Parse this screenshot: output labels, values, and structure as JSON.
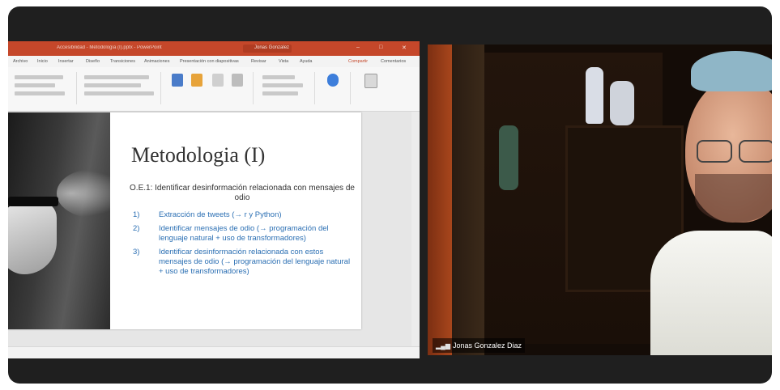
{
  "app": {
    "window_title": "Accesibilidad - Metodología (I).pptx - PowerPoint",
    "user": "Jonas Gonzalez",
    "share_label": "Compartir",
    "comments_label": "Comentarios"
  },
  "ribbon": {
    "tabs": [
      "Archivo",
      "Inicio",
      "Insertar",
      "Diseño",
      "Transiciones",
      "Animaciones",
      "Presentación con diapositivas",
      "Revisar",
      "Vista",
      "Ayuda"
    ]
  },
  "slide": {
    "title": "Metodologia (I)",
    "subtitle": "O.E.1: Identificar desinformación relacionada con mensajes de odio",
    "items": [
      {
        "num": "1)",
        "text": "Extracción de tweets (→ r y Python)"
      },
      {
        "num": "2)",
        "text": "Identificar mensajes de odio (→ programación del lenguaje natural + uso de transformadores)"
      },
      {
        "num": "3)",
        "text": "Identificar desinformación relacionada con estos mensajes de odio (→ programación del lenguaje natural + uso de transformadores)"
      }
    ]
  },
  "participant": {
    "name": "Jonas Gonzalez Diaz",
    "signal_icon": "signal-bars-icon"
  }
}
